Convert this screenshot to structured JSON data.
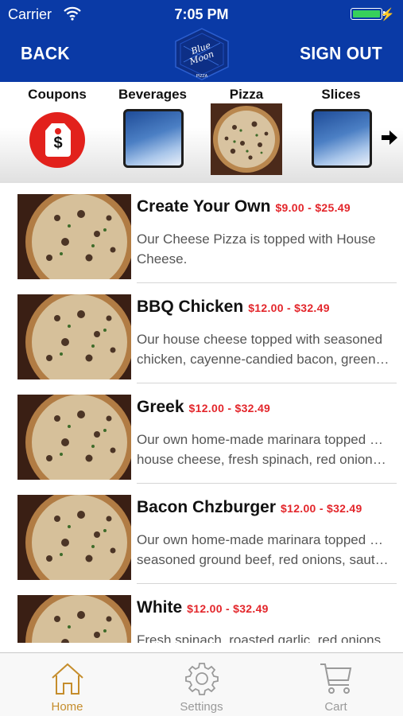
{
  "status_bar": {
    "carrier": "Carrier",
    "time": "7:05 PM"
  },
  "header": {
    "back_label": "BACK",
    "signout_label": "SIGN OUT",
    "logo_text": "Blue Moon",
    "logo_sub": "PIZZA"
  },
  "categories": [
    {
      "label": "Coupons",
      "icon": "coupon-tag-icon"
    },
    {
      "label": "Beverages",
      "icon": "blank-tile"
    },
    {
      "label": "Pizza",
      "icon": "pizza-photo"
    },
    {
      "label": "Slices",
      "icon": "blank-tile"
    }
  ],
  "menu_items": [
    {
      "name": "Create Your Own",
      "price": "$9.00 - $25.49",
      "desc_line1": "Our Cheese Pizza is topped with House",
      "desc_line2": "Cheese."
    },
    {
      "name": "BBQ Chicken",
      "price": "$12.00 - $32.49",
      "desc_line1": "Our house cheese topped with seasoned",
      "desc_line2": "chicken, cayenne-candied bacon, green…"
    },
    {
      "name": "Greek",
      "price": "$12.00 - $32.49",
      "desc_line1": "Our own home-made marinara topped with",
      "desc_line2": "house cheese, fresh spinach, red onions,…"
    },
    {
      "name": "Bacon Chzburger",
      "price": "$12.00 - $32.49",
      "desc_line1": "Our own home-made marinara topped with",
      "desc_line2": "seasoned ground beef, red onions, sautee…"
    },
    {
      "name": "White",
      "price": "$12.00 - $32.49",
      "desc_line1": "Fresh spinach, roasted garlic, red onions,",
      "desc_line2": ""
    }
  ],
  "tabs": [
    {
      "label": "Home",
      "icon": "home-icon",
      "active": true
    },
    {
      "label": "Settings",
      "icon": "gear-icon",
      "active": false
    },
    {
      "label": "Cart",
      "icon": "cart-icon",
      "active": false
    }
  ],
  "colors": {
    "header_bg": "#0a3aa6",
    "price": "#e3262b",
    "active_tab": "#c58d2c",
    "coupon_red": "#e2211c"
  }
}
